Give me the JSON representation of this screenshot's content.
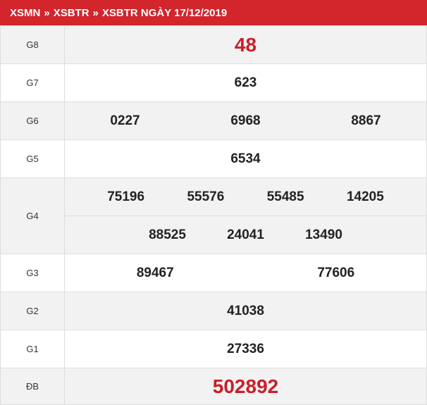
{
  "breadcrumb": {
    "item1": "XSMN",
    "item2": "XSBTR",
    "item3": "XSBTR NGÀY 17/12/2019",
    "separator": "»"
  },
  "results": {
    "g8": {
      "label": "G8",
      "values": [
        "48"
      ]
    },
    "g7": {
      "label": "G7",
      "values": [
        "623"
      ]
    },
    "g6": {
      "label": "G6",
      "values": [
        "0227",
        "6968",
        "8867"
      ]
    },
    "g5": {
      "label": "G5",
      "values": [
        "6534"
      ]
    },
    "g4": {
      "label": "G4",
      "values": [
        "75196",
        "55576",
        "55485",
        "14205",
        "88525",
        "24041",
        "13490"
      ]
    },
    "g3": {
      "label": "G3",
      "values": [
        "89467",
        "77606"
      ]
    },
    "g2": {
      "label": "G2",
      "values": [
        "41038"
      ]
    },
    "g1": {
      "label": "G1",
      "values": [
        "27336"
      ]
    },
    "db": {
      "label": "ĐB",
      "values": [
        "502892"
      ]
    }
  },
  "colors": {
    "header_bg": "#d2252c",
    "highlight": "#c81f2a",
    "shade": "#f2f2f2"
  }
}
